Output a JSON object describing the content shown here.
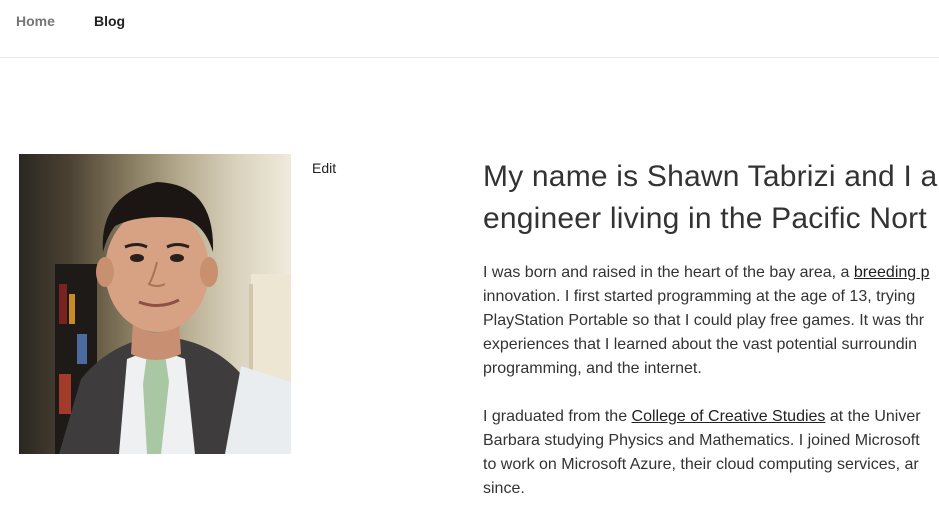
{
  "nav": {
    "home_label": "Home",
    "blog_label": "Blog"
  },
  "photo": {
    "alt": "Portrait of Shawn Tabrizi"
  },
  "edit_label": "Edit",
  "intro": {
    "heading_line1": "My name is Shawn Tabrizi and I ar",
    "heading_line2": "engineer living in the Pacific Nort",
    "para1": {
      "l1_text": "I was born and raised in the heart of the bay area, a ",
      "l1_link": "breeding p",
      "l2": "innovation. I first started programming at the age of 13, trying",
      "l3": "PlayStation Portable so that I could play free games. It was thr",
      "l4": "experiences that I learned about the vast potential surroundin",
      "l5": "programming, and the internet."
    },
    "para2": {
      "l1_pre": "I graduated from the ",
      "l1_link": "College of Creative Studies",
      "l1_post": " at the Univer",
      "l2": "Barbara studying Physics and Mathematics. I joined Microsoft",
      "l3": "to work on Microsoft Azure, their cloud computing services, ar",
      "l4": "since."
    }
  },
  "colors": {
    "nav_home": "#767676",
    "nav_active": "#222222",
    "text": "#333333",
    "divider": "#eaeaea"
  }
}
